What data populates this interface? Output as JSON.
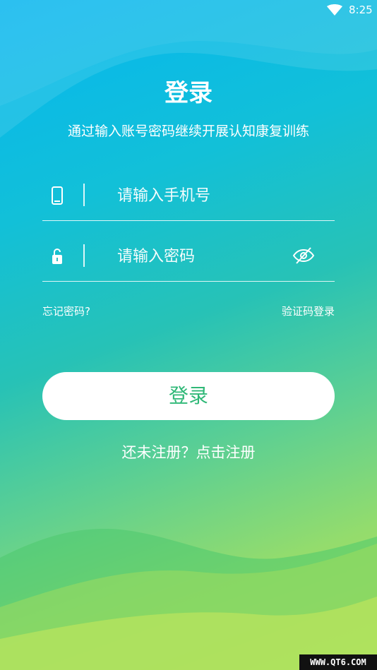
{
  "status_bar": {
    "time": "8:25",
    "icons": [
      "wifi-icon"
    ]
  },
  "header": {
    "title": "登录",
    "subtitle": "通过输入账号密码继续开展认知康复训练"
  },
  "form": {
    "phone": {
      "placeholder": "请输入手机号",
      "value": "",
      "icon": "phone-icon"
    },
    "password": {
      "placeholder": "请输入密码",
      "value": "",
      "icon": "lock-icon",
      "toggle_icon": "eye-off-icon"
    },
    "forgot_label": "忘记密码?",
    "sms_login_label": "验证码登录",
    "submit_label": "登录"
  },
  "footer": {
    "register_label": "还未注册？点击注册"
  },
  "watermark": "WWW.QT6.COM",
  "colors": {
    "accent_text": "#2fb877",
    "gradient_top": "#06b6f0",
    "gradient_bottom": "#b9e45b"
  }
}
